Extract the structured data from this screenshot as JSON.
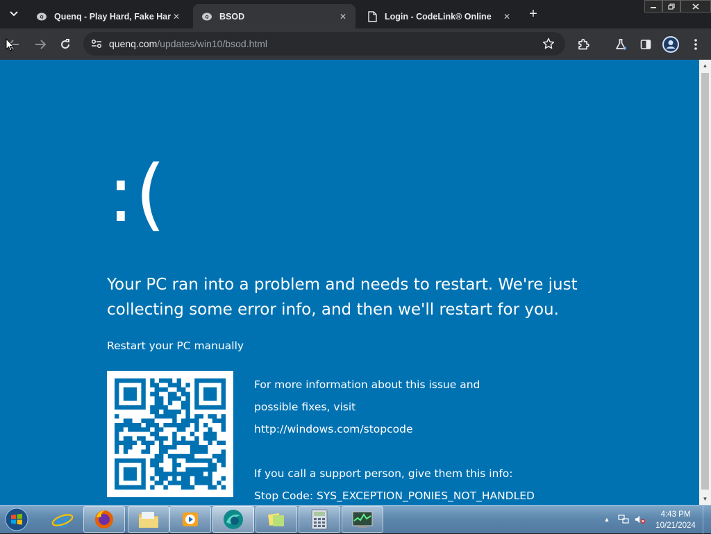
{
  "browser": {
    "tabs": [
      {
        "title": "Quenq - Play Hard, Fake Harder",
        "active": false
      },
      {
        "title": "BSOD",
        "active": true
      },
      {
        "title": "Login - CodeLink® Online",
        "active": false
      }
    ],
    "address": {
      "host": "quenq.com",
      "path": "/updates/win10/bsod.html"
    }
  },
  "page": {
    "emoticon": ":(",
    "headline": "Your PC ran into a problem and needs to restart. We're just collecting some error info, and then we'll restart for you.",
    "restart_manually": "Restart your PC manually",
    "info_line_1": "For more information about this issue and",
    "info_line_2": "possible fixes, visit",
    "info_link": "http://windows.com/stopcode",
    "support_line": "If you call a support person, give them this info:",
    "stop_code": "Stop Code: SYS_EXCEPTION_PONIES_NOT_HANDLED",
    "background_color": "#0072b2"
  },
  "taskbar": {
    "apps": [
      "internet-explorer",
      "firefox",
      "file-explorer",
      "media-player",
      "browser-app",
      "sticky-notes",
      "calculator",
      "system-monitor"
    ],
    "clock_time": "4:43 PM",
    "clock_date": "10/21/2024"
  }
}
